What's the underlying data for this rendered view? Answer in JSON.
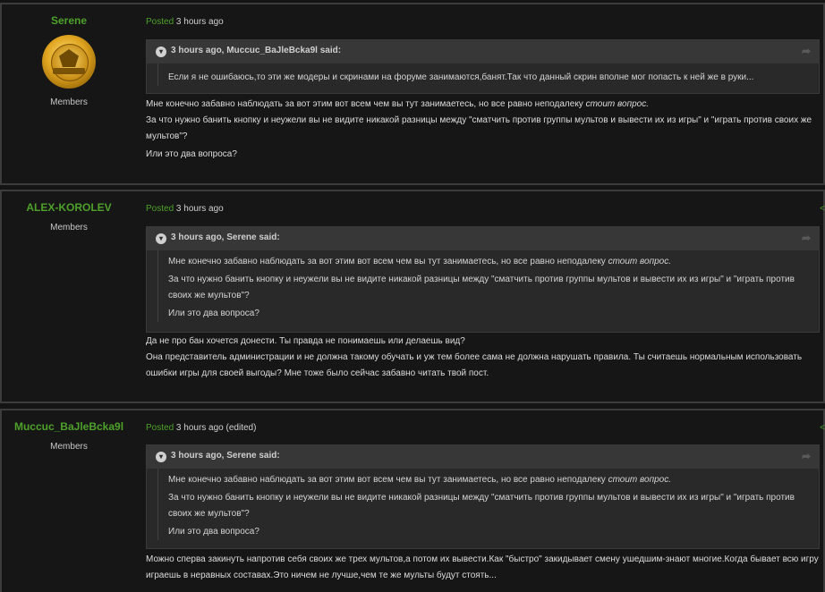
{
  "posts": [
    {
      "author": "Serene",
      "has_avatar": true,
      "group": "Members",
      "posted_label": "Posted",
      "time": "3 hours ago",
      "edited": "",
      "quote": {
        "citation": "3 hours ago, Muccuc_BaJleBcka9l said:",
        "lines": [
          "Если я не ошибаюсь,то эти же модеры и скринами на форуме занимаются,банят.Так что данный скрин вполне мог попасть к ней же в руки..."
        ]
      },
      "body": {
        "line1_pre": "Мне конечно забавно наблюдать за вот этим вот всем чем вы тут занимаетесь, но все равно неподалеку ",
        "line1_em": "стоит вопрос.",
        "line2": "За что нужно банить кнопку и неужели вы не видите никакой разницы между \"сматчить против группы мультов и вывести их из игры\" и \"играть против своих же мультов\"?",
        "line3": "Или это два вопроса?"
      }
    },
    {
      "author": "ALEX-KOROLEV",
      "has_avatar": false,
      "group": "Members",
      "posted_label": "Posted",
      "time": "3 hours ago",
      "edited": "",
      "quote": {
        "citation": "3 hours ago, Serene said:",
        "line1_pre": "Мне конечно забавно наблюдать за вот этим вот всем чем вы тут занимаетесь, но все равно неподалеку ",
        "line1_em": "стоит вопрос.",
        "line2": "За что нужно банить кнопку и неужели вы не видите никакой разницы между \"сматчить против группы мультов и вывести их из игры\" и \"играть против своих же мультов\"?",
        "line3": "Или это два вопроса?"
      },
      "body": {
        "line1": "Да не про бан хочется донести. Ты правда не понимаешь или делаешь вид?",
        "line2": "Она представитель администрации и не должна такому обучать и уж тем более сама не должна нарушать правила. Ты считаешь нормальным использовать ошибки игры для своей выгоды? Мне тоже было сейчас забавно читать твой пост."
      }
    },
    {
      "author": "Muccuc_BaJleBcka9l",
      "has_avatar": false,
      "group": "Members",
      "posted_label": "Posted",
      "time": "3 hours ago",
      "edited": "(edited)",
      "quote": {
        "citation": "3 hours ago, Serene said:",
        "line1_pre": "Мне конечно забавно наблюдать за вот этим вот всем чем вы тут занимаетесь, но все равно неподалеку ",
        "line1_em": "стоит вопрос.",
        "line2": "За что нужно банить кнопку и неужели вы не видите никакой разницы между \"сматчить против группы мультов и вывести их из игры\" и \"играть против своих же мультов\"?",
        "line3": "Или это два вопроса?"
      },
      "body": {
        "line1": "Можно сперва закинуть напротив себя своих же трех мультов,а потом их вывести.Как \"быстро\" закидывает смену ушедшим-знают многие.Когда бывает всю игру играешь в неравных составах.Это ничем не лучше,чем те же мульты будут стоять..."
      }
    }
  ],
  "colors": {
    "author": "#4ea12a",
    "posted": "#4ea12a",
    "background": "#141414",
    "quote_head": "#373737"
  },
  "icons": {
    "collapse": "chevron-down-icon",
    "jump": "jump-to-post-icon",
    "share": "share-icon"
  }
}
